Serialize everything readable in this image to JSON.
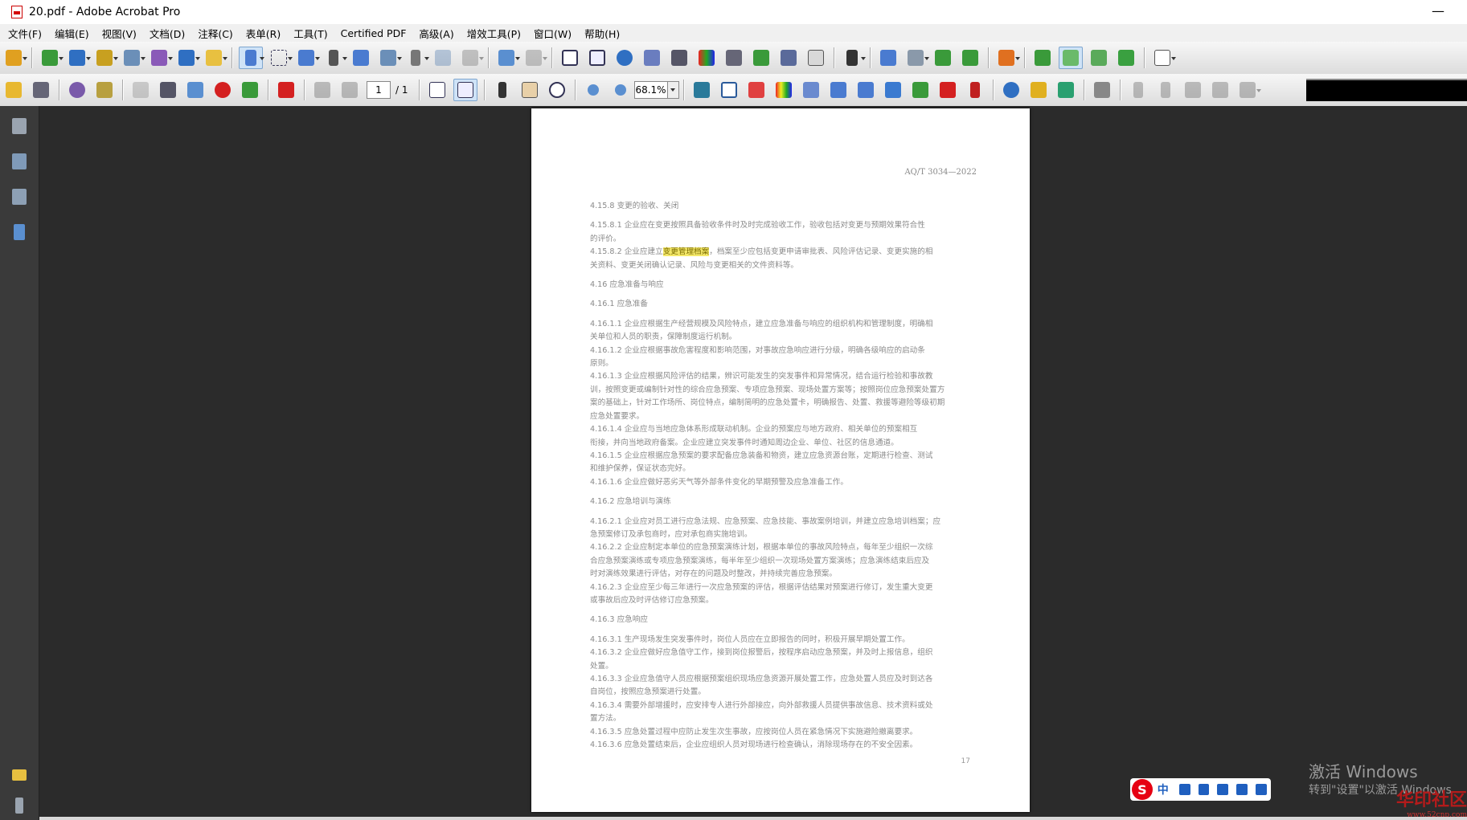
{
  "window": {
    "title": "20.pdf - Adobe Acrobat Pro",
    "minimize_glyph": "—"
  },
  "menu": [
    "文件(F)",
    "编辑(E)",
    "视图(V)",
    "文档(D)",
    "注释(C)",
    "表单(R)",
    "工具(T)",
    "Certified PDF",
    "高级(A)",
    "增效工具(P)",
    "窗口(W)",
    "帮助(H)"
  ],
  "toolbar": {
    "page_current": "1",
    "page_total": "/ 1",
    "zoom": "68.1%"
  },
  "document": {
    "header": "AQ/T 3034—2022",
    "page_number": "17",
    "highlighted_term": "变更管理档案",
    "lines": [
      {
        "t": "4.15.8  变更的验收、关闭",
        "c": "head"
      },
      {
        "t": "4.15.8.1  企业应在变更按照具备验收条件时及时完成验收工作，验收包括对变更与预期效果符合性",
        "c": "gap"
      },
      {
        "t": "的评价。",
        "c": "cont"
      },
      {
        "t": "HL",
        "c": ""
      },
      {
        "t": "关资料、变更关闭确认记录、风险与变更相关的文件资料等。",
        "c": "cont"
      },
      {
        "t": "4.16  应急准备与响应",
        "c": "gap"
      },
      {
        "t": "4.16.1  应急准备",
        "c": "gap"
      },
      {
        "t": "4.16.1.1  企业应根据生产经营规模及风险特点，建立应急准备与响应的组织机构和管理制度，明确相",
        "c": "gap"
      },
      {
        "t": "关单位和人员的职责，保障制度运行机制。",
        "c": "cont"
      },
      {
        "t": "4.16.1.2  企业应根据事故危害程度和影响范围，对事故应急响应进行分级，明确各级响应的启动条",
        "c": ""
      },
      {
        "t": "原则。",
        "c": "cont"
      },
      {
        "t": "4.16.1.3  企业应根据风险评估的结果，辨识可能发生的突发事件和异常情况，结合运行检验和事故教",
        "c": ""
      },
      {
        "t": "训，按照变更或编制针对性的综合应急预案、专项应急预案、现场处置方案等；按照岗位应急预案处置方",
        "c": "cont"
      },
      {
        "t": "案的基础上，针对工作场所、岗位特点，编制简明的应急处置卡，明确报告、处置、救援等避险等级初期",
        "c": "cont"
      },
      {
        "t": "应急处置要求。",
        "c": "cont"
      },
      {
        "t": "4.16.1.4  企业应与当地应急体系形成联动机制。企业的预案应与地方政府、相关单位的预案相互",
        "c": ""
      },
      {
        "t": "衔接，并向当地政府备案。企业应建立突发事件时通知周边企业、单位、社区的信息通道。",
        "c": "cont"
      },
      {
        "t": "4.16.1.5  企业应根据应急预案的要求配备应急装备和物资，建立应急资源台账，定期进行检查、测试",
        "c": ""
      },
      {
        "t": "和维护保养，保证状态完好。",
        "c": "cont"
      },
      {
        "t": "4.16.1.6  企业应做好恶劣天气等外部条件变化的早期预警及应急准备工作。",
        "c": ""
      },
      {
        "t": "4.16.2  应急培训与演练",
        "c": "gap"
      },
      {
        "t": "4.16.2.1  企业应对员工进行应急法规、应急预案、应急技能、事故案例培训，并建立应急培训档案；应",
        "c": "gap"
      },
      {
        "t": "急预案修订及承包商时，应对承包商实施培训。",
        "c": "cont"
      },
      {
        "t": "4.16.2.2  企业应制定本单位的应急预案演练计划，根据本单位的事故风险特点，每年至少组织一次综",
        "c": ""
      },
      {
        "t": "合应急预案演练或专项应急预案演练，每半年至少组织一次现场处置方案演练；应急演练结束后应及",
        "c": "cont"
      },
      {
        "t": "时对演练效果进行评估，对存在的问题及时整改，并持续完善应急预案。",
        "c": "cont"
      },
      {
        "t": "4.16.2.3  企业应至少每三年进行一次应急预案的评估，根据评估结果对预案进行修订，发生重大变更",
        "c": ""
      },
      {
        "t": "或事故后应及时评估修订应急预案。",
        "c": "cont"
      },
      {
        "t": "4.16.3  应急响应",
        "c": "gap"
      },
      {
        "t": "4.16.3.1  生产现场发生突发事件时，岗位人员应在立即报告的同时，积极开展早期处置工作。",
        "c": "gap"
      },
      {
        "t": "4.16.3.2  企业应做好应急值守工作，接到岗位报警后，按程序启动应急预案，并及时上报信息，组织",
        "c": ""
      },
      {
        "t": "处置。",
        "c": "cont"
      },
      {
        "t": "4.16.3.3  企业应急值守人员应根据预案组织现场应急资源开展处置工作，应急处置人员应及时到达各",
        "c": ""
      },
      {
        "t": "自岗位，按照应急预案进行处置。",
        "c": "cont"
      },
      {
        "t": "4.16.3.4  需要外部增援时，应安排专人进行外部接应，向外部救援人员提供事故信息、技术资料或处",
        "c": ""
      },
      {
        "t": "置方法。",
        "c": "cont"
      },
      {
        "t": "4.16.3.5  应急处置过程中应防止发生次生事故，应按岗位人员在紧急情况下实施避险撤离要求。",
        "c": ""
      },
      {
        "t": "4.16.3.6  应急处置结束后，企业应组织人员对现场进行检查确认，消除现场存在的不安全因素。",
        "c": ""
      }
    ],
    "hl_line_pre": "4.15.8.2  企业应建立",
    "hl_line_post": "，档案至少应包括变更申请审批表、风险评估记录、变更实施的相"
  },
  "os": {
    "activate_line1": "激活 Windows",
    "activate_line2": "转到\"设置\"以激活 Windows",
    "ime_label": "中",
    "logo_text": "华印社区",
    "logo_sub": "www.52cnp.com"
  },
  "icon_colors": {
    "primary": "#2f6fc2",
    "accent": "#e0a020",
    "danger": "#d42020",
    "green": "#3a9a3a"
  }
}
